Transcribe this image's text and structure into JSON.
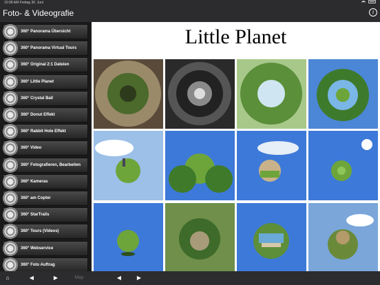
{
  "status": {
    "time": "10:08 AM  Freitag 30. Juni"
  },
  "header": {
    "title": "Foto- & Videografie",
    "info_icon": "info-icon"
  },
  "sidebar": {
    "items": [
      {
        "label": "360° Panorama Übersicht"
      },
      {
        "label": "360° Panorama Virtual Tours"
      },
      {
        "label": "360° Original 2:1 Dateien"
      },
      {
        "label": "360° Little Planet"
      },
      {
        "label": "360° Crystal Ball"
      },
      {
        "label": "360° Donut Effekt"
      },
      {
        "label": "360° Rabbit Hole Effekt"
      },
      {
        "label": "360° Video"
      },
      {
        "label": "360° Fotografieren, Bearbeiten"
      },
      {
        "label": "360° Kameras"
      },
      {
        "label": "360° am Copter"
      },
      {
        "label": "360° StarTrails"
      },
      {
        "label": "360° Tours (Videos)"
      },
      {
        "label": "360° Webservice"
      },
      {
        "label": "360° Foto Auftrag"
      }
    ]
  },
  "main": {
    "heading": "Little Planet",
    "photos": [
      {
        "name": "photo-tunnel-tree"
      },
      {
        "name": "photo-tunnel-dark"
      },
      {
        "name": "photo-trees-up"
      },
      {
        "name": "photo-planet-bright"
      },
      {
        "name": "photo-planet-clouds"
      },
      {
        "name": "photo-planet-trees"
      },
      {
        "name": "photo-planet-round"
      },
      {
        "name": "photo-planet-sun"
      },
      {
        "name": "photo-planet-blue"
      },
      {
        "name": "photo-planet-trees-2"
      },
      {
        "name": "photo-planet-building"
      },
      {
        "name": "photo-planet-sky"
      }
    ]
  },
  "toolbar": {
    "home": "⌂",
    "back": "◀",
    "forward": "▶",
    "map": "Map",
    "prev": "◀",
    "next": "▶"
  },
  "colors": {
    "bar": "#2c2c2e",
    "sky": "#3d79d8",
    "grass": "#6ea53b"
  }
}
